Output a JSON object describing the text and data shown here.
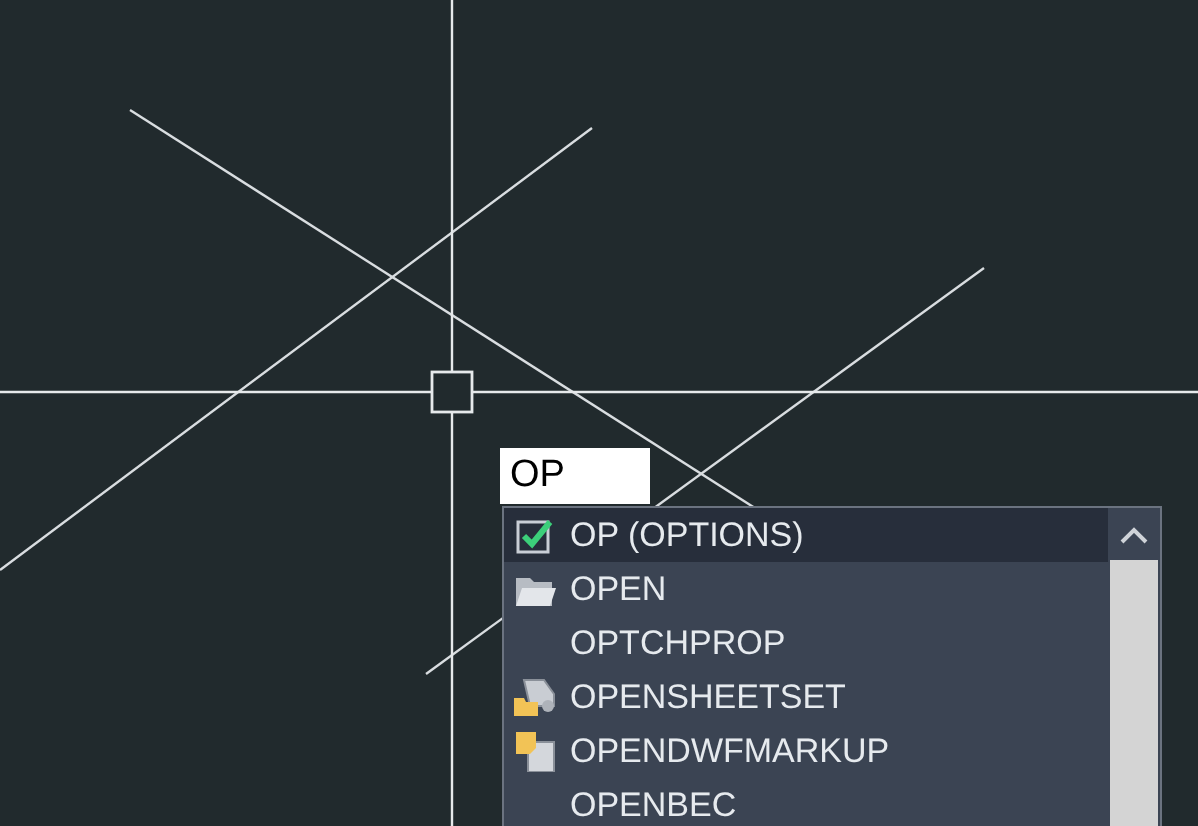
{
  "command_input": {
    "value": "OP"
  },
  "suggestions": [
    {
      "label": "OP (OPTIONS)",
      "kind": "options",
      "selected": true
    },
    {
      "label": "OPEN",
      "kind": "open",
      "selected": false
    },
    {
      "label": "OPTCHPROP",
      "kind": "plain",
      "selected": false
    },
    {
      "label": "OPENSHEETSET",
      "kind": "sheetset",
      "selected": false
    },
    {
      "label": "OPENDWFMARKUP",
      "kind": "markup",
      "selected": false
    },
    {
      "label": "OPENBEC",
      "kind": "plain",
      "selected": false
    }
  ]
}
